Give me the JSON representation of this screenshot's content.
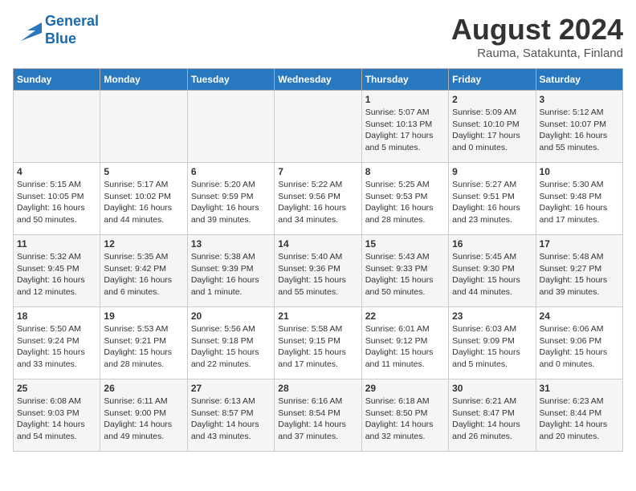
{
  "header": {
    "logo_line1": "General",
    "logo_line2": "Blue",
    "month_year": "August 2024",
    "location": "Rauma, Satakunta, Finland"
  },
  "days_of_week": [
    "Sunday",
    "Monday",
    "Tuesday",
    "Wednesday",
    "Thursday",
    "Friday",
    "Saturday"
  ],
  "weeks": [
    [
      {
        "day": "",
        "sunrise": "",
        "sunset": "",
        "daylight": ""
      },
      {
        "day": "",
        "sunrise": "",
        "sunset": "",
        "daylight": ""
      },
      {
        "day": "",
        "sunrise": "",
        "sunset": "",
        "daylight": ""
      },
      {
        "day": "",
        "sunrise": "",
        "sunset": "",
        "daylight": ""
      },
      {
        "day": "1",
        "sunrise": "Sunrise: 5:07 AM",
        "sunset": "Sunset: 10:13 PM",
        "daylight": "Daylight: 17 hours and 5 minutes."
      },
      {
        "day": "2",
        "sunrise": "Sunrise: 5:09 AM",
        "sunset": "Sunset: 10:10 PM",
        "daylight": "Daylight: 17 hours and 0 minutes."
      },
      {
        "day": "3",
        "sunrise": "Sunrise: 5:12 AM",
        "sunset": "Sunset: 10:07 PM",
        "daylight": "Daylight: 16 hours and 55 minutes."
      }
    ],
    [
      {
        "day": "4",
        "sunrise": "Sunrise: 5:15 AM",
        "sunset": "Sunset: 10:05 PM",
        "daylight": "Daylight: 16 hours and 50 minutes."
      },
      {
        "day": "5",
        "sunrise": "Sunrise: 5:17 AM",
        "sunset": "Sunset: 10:02 PM",
        "daylight": "Daylight: 16 hours and 44 minutes."
      },
      {
        "day": "6",
        "sunrise": "Sunrise: 5:20 AM",
        "sunset": "Sunset: 9:59 PM",
        "daylight": "Daylight: 16 hours and 39 minutes."
      },
      {
        "day": "7",
        "sunrise": "Sunrise: 5:22 AM",
        "sunset": "Sunset: 9:56 PM",
        "daylight": "Daylight: 16 hours and 34 minutes."
      },
      {
        "day": "8",
        "sunrise": "Sunrise: 5:25 AM",
        "sunset": "Sunset: 9:53 PM",
        "daylight": "Daylight: 16 hours and 28 minutes."
      },
      {
        "day": "9",
        "sunrise": "Sunrise: 5:27 AM",
        "sunset": "Sunset: 9:51 PM",
        "daylight": "Daylight: 16 hours and 23 minutes."
      },
      {
        "day": "10",
        "sunrise": "Sunrise: 5:30 AM",
        "sunset": "Sunset: 9:48 PM",
        "daylight": "Daylight: 16 hours and 17 minutes."
      }
    ],
    [
      {
        "day": "11",
        "sunrise": "Sunrise: 5:32 AM",
        "sunset": "Sunset: 9:45 PM",
        "daylight": "Daylight: 16 hours and 12 minutes."
      },
      {
        "day": "12",
        "sunrise": "Sunrise: 5:35 AM",
        "sunset": "Sunset: 9:42 PM",
        "daylight": "Daylight: 16 hours and 6 minutes."
      },
      {
        "day": "13",
        "sunrise": "Sunrise: 5:38 AM",
        "sunset": "Sunset: 9:39 PM",
        "daylight": "Daylight: 16 hours and 1 minute."
      },
      {
        "day": "14",
        "sunrise": "Sunrise: 5:40 AM",
        "sunset": "Sunset: 9:36 PM",
        "daylight": "Daylight: 15 hours and 55 minutes."
      },
      {
        "day": "15",
        "sunrise": "Sunrise: 5:43 AM",
        "sunset": "Sunset: 9:33 PM",
        "daylight": "Daylight: 15 hours and 50 minutes."
      },
      {
        "day": "16",
        "sunrise": "Sunrise: 5:45 AM",
        "sunset": "Sunset: 9:30 PM",
        "daylight": "Daylight: 15 hours and 44 minutes."
      },
      {
        "day": "17",
        "sunrise": "Sunrise: 5:48 AM",
        "sunset": "Sunset: 9:27 PM",
        "daylight": "Daylight: 15 hours and 39 minutes."
      }
    ],
    [
      {
        "day": "18",
        "sunrise": "Sunrise: 5:50 AM",
        "sunset": "Sunset: 9:24 PM",
        "daylight": "Daylight: 15 hours and 33 minutes."
      },
      {
        "day": "19",
        "sunrise": "Sunrise: 5:53 AM",
        "sunset": "Sunset: 9:21 PM",
        "daylight": "Daylight: 15 hours and 28 minutes."
      },
      {
        "day": "20",
        "sunrise": "Sunrise: 5:56 AM",
        "sunset": "Sunset: 9:18 PM",
        "daylight": "Daylight: 15 hours and 22 minutes."
      },
      {
        "day": "21",
        "sunrise": "Sunrise: 5:58 AM",
        "sunset": "Sunset: 9:15 PM",
        "daylight": "Daylight: 15 hours and 17 minutes."
      },
      {
        "day": "22",
        "sunrise": "Sunrise: 6:01 AM",
        "sunset": "Sunset: 9:12 PM",
        "daylight": "Daylight: 15 hours and 11 minutes."
      },
      {
        "day": "23",
        "sunrise": "Sunrise: 6:03 AM",
        "sunset": "Sunset: 9:09 PM",
        "daylight": "Daylight: 15 hours and 5 minutes."
      },
      {
        "day": "24",
        "sunrise": "Sunrise: 6:06 AM",
        "sunset": "Sunset: 9:06 PM",
        "daylight": "Daylight: 15 hours and 0 minutes."
      }
    ],
    [
      {
        "day": "25",
        "sunrise": "Sunrise: 6:08 AM",
        "sunset": "Sunset: 9:03 PM",
        "daylight": "Daylight: 14 hours and 54 minutes."
      },
      {
        "day": "26",
        "sunrise": "Sunrise: 6:11 AM",
        "sunset": "Sunset: 9:00 PM",
        "daylight": "Daylight: 14 hours and 49 minutes."
      },
      {
        "day": "27",
        "sunrise": "Sunrise: 6:13 AM",
        "sunset": "Sunset: 8:57 PM",
        "daylight": "Daylight: 14 hours and 43 minutes."
      },
      {
        "day": "28",
        "sunrise": "Sunrise: 6:16 AM",
        "sunset": "Sunset: 8:54 PM",
        "daylight": "Daylight: 14 hours and 37 minutes."
      },
      {
        "day": "29",
        "sunrise": "Sunrise: 6:18 AM",
        "sunset": "Sunset: 8:50 PM",
        "daylight": "Daylight: 14 hours and 32 minutes."
      },
      {
        "day": "30",
        "sunrise": "Sunrise: 6:21 AM",
        "sunset": "Sunset: 8:47 PM",
        "daylight": "Daylight: 14 hours and 26 minutes."
      },
      {
        "day": "31",
        "sunrise": "Sunrise: 6:23 AM",
        "sunset": "Sunset: 8:44 PM",
        "daylight": "Daylight: 14 hours and 20 minutes."
      }
    ]
  ]
}
